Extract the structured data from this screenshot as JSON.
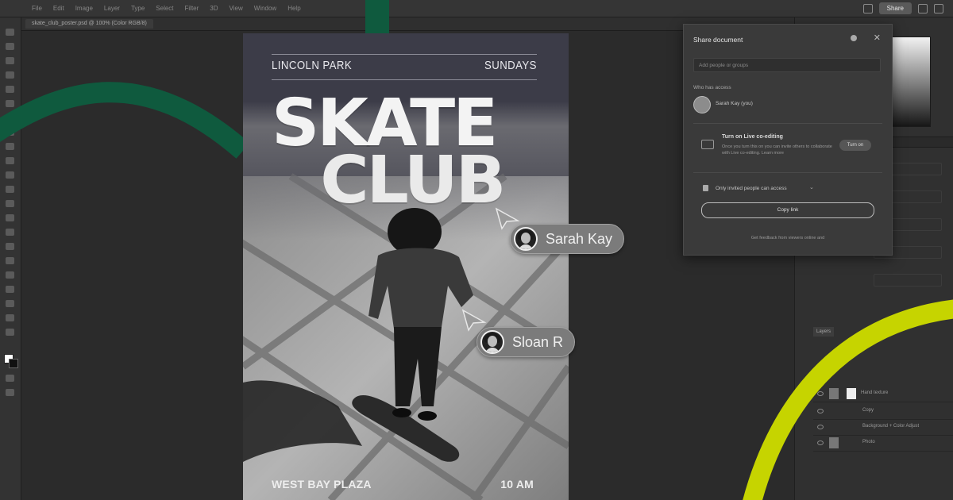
{
  "menubar": {
    "items": [
      "File",
      "Edit",
      "Image",
      "Layer",
      "Type",
      "Select",
      "Filter",
      "3D",
      "View",
      "Window",
      "Help"
    ],
    "share_label": "Share"
  },
  "document_tab": "skate_club_poster.psd @ 100% (Color RGB/8)",
  "poster": {
    "location": "LINCOLN PARK",
    "day": "SUNDAYS",
    "title_line1": "SKATE",
    "title_line2": "CLUB",
    "venue": "WEST BAY PLAZA",
    "time": "10 AM"
  },
  "collaborators": [
    {
      "name": "Sarah Kay"
    },
    {
      "name": "Sloan R"
    }
  ],
  "share_dialog": {
    "title": "Share document",
    "input_placeholder": "Add people or groups",
    "who_has_access": "Who has access",
    "owner": "Sarah Kay (you)",
    "live_title": "Turn on Live co-editing",
    "live_desc": "Once you turn this on you can invite others to collaborate with Live co-editing. Learn more",
    "turn_on_label": "Turn on",
    "access_text": "Only invited people can access",
    "copy_link_label": "Copy link",
    "feedback_text": "Get feedback from viewers online and"
  },
  "layers": {
    "tab_label": "Layers",
    "rows": [
      "Hand texture",
      "Copy",
      "Background + Color Adjust",
      "Photo"
    ]
  },
  "colors": {
    "background": "#2b2b2b",
    "dark_green_curve": "#0f5a3e",
    "lime_curve": "#c6d400",
    "poster_top": "#3c3c48"
  },
  "icons": {
    "cursor": "arrow-cursor-icon",
    "gear": "gear-icon",
    "close": "close-icon",
    "lock": "lock-icon"
  }
}
